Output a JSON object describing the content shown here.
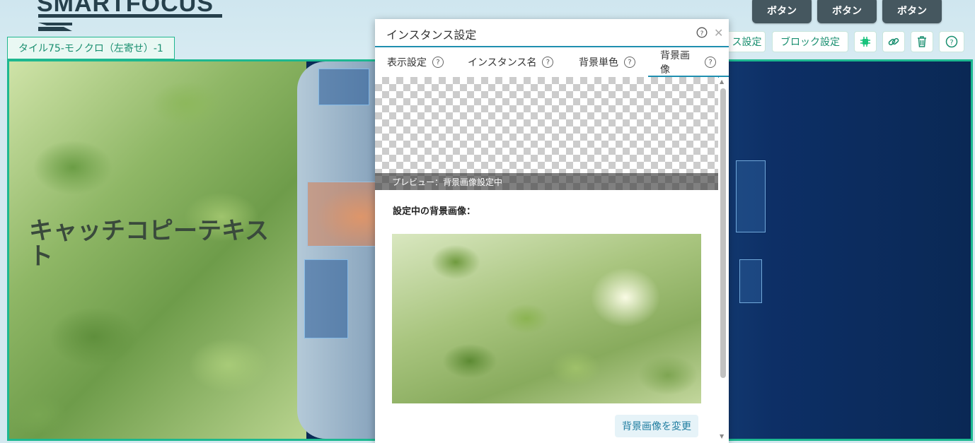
{
  "header": {
    "logo_text": "SMARTFOCUS",
    "buttons": [
      "ボタン",
      "ボタン",
      "ボタン"
    ]
  },
  "block_tag": "タイル75-モノクロ（左寄せ）-1",
  "toolbar": {
    "instance_settings_label": "ス設定",
    "block_settings_label": "ブロック設定",
    "icons": [
      "cpu-icon",
      "link-icon",
      "trash-icon",
      "help-icon"
    ]
  },
  "content": {
    "catch_copy": "キャッチコピーテキスト"
  },
  "dialog": {
    "title": "インスタンス設定",
    "tabs": [
      {
        "label": "表示設定"
      },
      {
        "label": "インスタンス名"
      },
      {
        "label": "背景単色"
      },
      {
        "label": "背景画像"
      }
    ],
    "active_tab": "背景画像",
    "preview_caption": "プレビュー：背景画像設定中",
    "current_bg_label": "設定中の背景画像：",
    "change_button": "背景画像を変更"
  },
  "colors": {
    "accent_green": "#1db890",
    "accent_blue": "#1f8fb0",
    "header_button": "#45575f"
  }
}
